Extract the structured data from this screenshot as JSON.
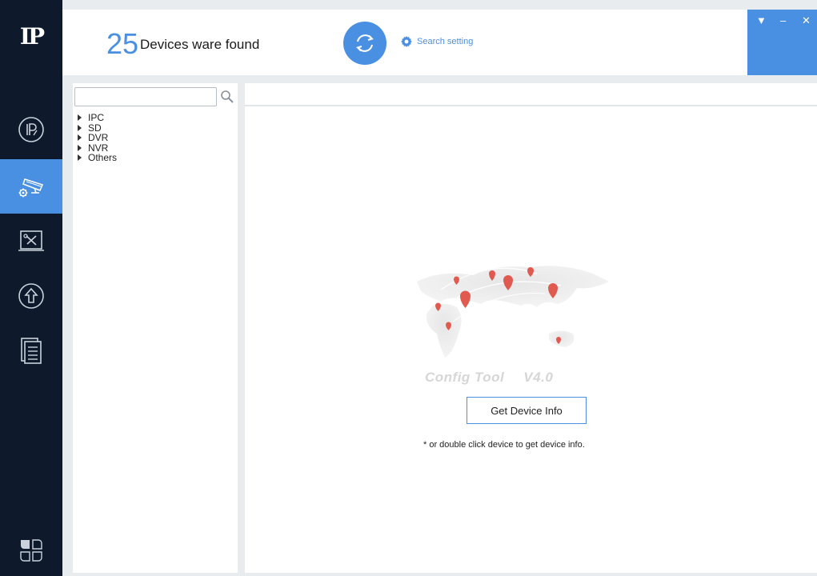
{
  "app": {
    "logo_text": "IP",
    "accent_color": "#4a90e2",
    "sidebar_color": "#0e1a2b"
  },
  "sidebar": {
    "items": [
      {
        "name": "ip-edit-icon",
        "active": false
      },
      {
        "name": "camera-settings-icon",
        "active": true
      },
      {
        "name": "tools-icon",
        "active": false
      },
      {
        "name": "upgrade-icon",
        "active": false
      },
      {
        "name": "document-list-icon",
        "active": false
      }
    ],
    "bottom_icon": "apps-grid-icon"
  },
  "header": {
    "device_count": "25",
    "found_label": "Devices ware found",
    "refresh_icon": "refresh-icon",
    "search_setting_label": "Search setting",
    "window_controls": [
      "▼",
      "–",
      "✕"
    ]
  },
  "tree": {
    "search_value": "",
    "search_placeholder": "",
    "items": [
      {
        "label": "IPC"
      },
      {
        "label": "SD"
      },
      {
        "label": "DVR"
      },
      {
        "label": "NVR"
      },
      {
        "label": "Others"
      }
    ]
  },
  "main": {
    "product_name": "Config Tool",
    "product_version": "V4.0",
    "get_info_button": "Get Device Info",
    "hint": "* or double click device to get device info."
  }
}
